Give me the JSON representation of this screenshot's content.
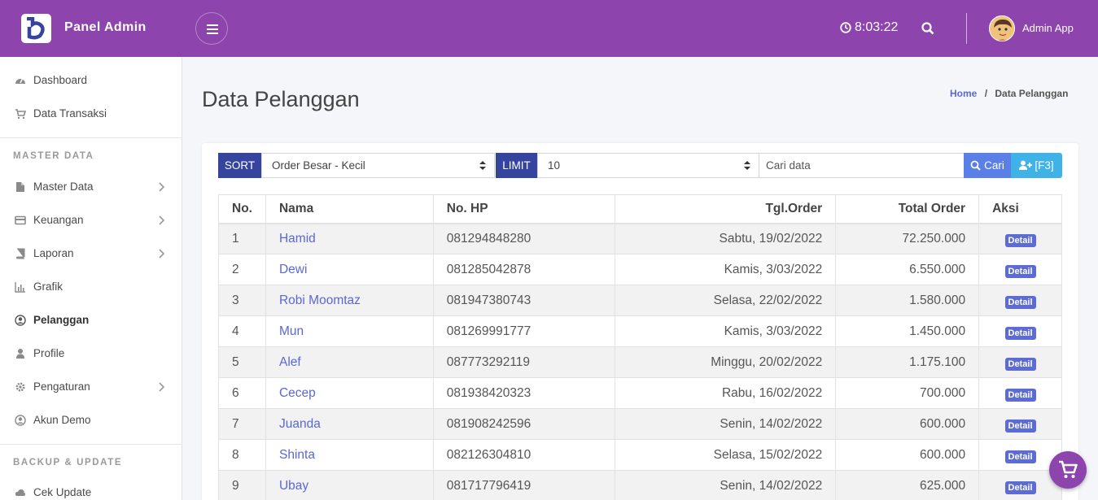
{
  "topbar": {
    "brand": "Panel Admin",
    "clock": "8:03:22",
    "username": "Admin App",
    "color": "#8e44ad"
  },
  "sidebar": {
    "items_main": [
      {
        "label": "Dashboard",
        "icon": "dashboard-icon"
      },
      {
        "label": "Data Transaksi",
        "icon": "cart-icon"
      }
    ],
    "section_master": "MASTER DATA",
    "items_master": [
      {
        "label": "Master Data",
        "icon": "file-icon"
      },
      {
        "label": "Keuangan",
        "icon": "card-icon"
      },
      {
        "label": "Laporan",
        "icon": "book-icon"
      },
      {
        "label": "Grafik",
        "icon": "chart-icon"
      },
      {
        "label": "Pelanggan",
        "icon": "user-circle-icon"
      },
      {
        "label": "Profile",
        "icon": "user-icon"
      },
      {
        "label": "Pengaturan",
        "icon": "gear-icon"
      },
      {
        "label": "Akun Demo",
        "icon": "user-circle-icon"
      }
    ],
    "section_backup": "BACKUP & UPDATE",
    "items_backup": [
      {
        "label": "Cek Update",
        "icon": "cloud-icon"
      }
    ]
  },
  "page": {
    "title": "Data Pelanggan",
    "breadcrumb_home": "Home",
    "breadcrumb_sep": "/",
    "breadcrumb_current": "Data Pelanggan"
  },
  "filter": {
    "sort_label": "SORT",
    "sort_value": "Order Besar - Kecil",
    "limit_label": "LIMIT",
    "limit_value": "10",
    "search_placeholder": "Cari data",
    "search_button": "Cari",
    "add_button": "[F3]"
  },
  "table": {
    "headers": [
      "No.",
      "Nama",
      "No. HP",
      "Tgl.Order",
      "Total Order",
      "Aksi"
    ],
    "action_label": "Detail",
    "rows": [
      {
        "no": "1",
        "nama": "Hamid",
        "hp": "081294848280",
        "tgl": "Sabtu, 19/02/2022",
        "total": "72.250.000"
      },
      {
        "no": "2",
        "nama": "Dewi",
        "hp": "081285042878",
        "tgl": "Kamis, 3/03/2022",
        "total": "6.550.000"
      },
      {
        "no": "3",
        "nama": "Robi Moomtaz",
        "hp": "081947380743",
        "tgl": "Selasa, 22/02/2022",
        "total": "1.580.000"
      },
      {
        "no": "4",
        "nama": "Mun",
        "hp": "081269991777",
        "tgl": "Kamis, 3/03/2022",
        "total": "1.450.000"
      },
      {
        "no": "5",
        "nama": "Alef",
        "hp": "087773292119",
        "tgl": "Minggu, 20/02/2022",
        "total": "1.175.100"
      },
      {
        "no": "6",
        "nama": "Cecep",
        "hp": "081938420323",
        "tgl": "Rabu, 16/02/2022",
        "total": "700.000"
      },
      {
        "no": "7",
        "nama": "Juanda",
        "hp": "081908242596",
        "tgl": "Senin, 14/02/2022",
        "total": "600.000"
      },
      {
        "no": "8",
        "nama": "Shinta",
        "hp": "082126304810",
        "tgl": "Selasa, 15/02/2022",
        "total": "600.000"
      },
      {
        "no": "9",
        "nama": "Ubay",
        "hp": "081717796419",
        "tgl": "Senin, 14/02/2022",
        "total": "625.000"
      }
    ]
  }
}
